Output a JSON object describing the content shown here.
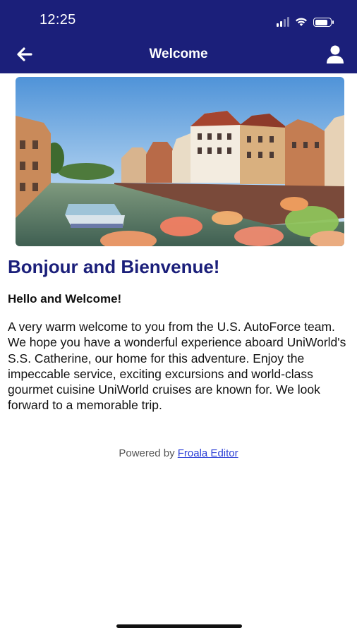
{
  "status_bar": {
    "time": "12:25",
    "signal_icon": "signal-icon",
    "wifi_icon": "wifi-icon",
    "battery_icon": "battery-icon",
    "battery_level": 0.85
  },
  "nav": {
    "title": "Welcome",
    "back_icon": "arrow-left-icon",
    "profile_icon": "user-icon"
  },
  "colors": {
    "nav_background": "#1b1f7a",
    "heading": "#1b1f7a",
    "link": "#2b3fd6"
  },
  "content": {
    "hero_image": "canal-town-photo",
    "heading": "Bonjour and Bienvenue!",
    "subheading": "Hello and Welcome!",
    "body": "A very warm welcome to you from the U.S. AutoForce team. We hope you have a wonderful experience aboard UniWorld's S.S. Catherine, our home for this adventure. Enjoy the impeccable service, exciting excursions and world-class gourmet cuisine UniWorld cruises are known for. We look forward to a memorable trip."
  },
  "footer": {
    "powered_prefix": "Powered by",
    "powered_link": "Froala Editor"
  }
}
